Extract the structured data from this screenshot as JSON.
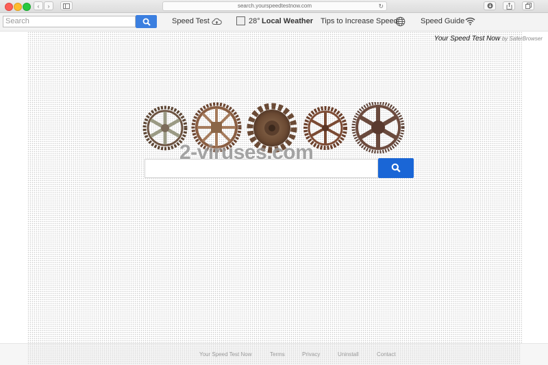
{
  "browser": {
    "url": "search.yourspeedtestnow.com"
  },
  "toolbar": {
    "search_placeholder": "Search",
    "speed_test_label": "Speed Test",
    "weather_temp": "28°",
    "weather_label": "Local Weather",
    "tips_label": "Tips to Increase Speed",
    "speed_guide_label": "Speed Guide"
  },
  "brand": {
    "name": "Your Speed Test Now",
    "by": "by SaferBrowser"
  },
  "watermark": "2-viruses.com",
  "footer": {
    "links": [
      "Your Speed Test Now",
      "Terms",
      "Privacy",
      "Uninstall",
      "Contact"
    ]
  },
  "colors": {
    "search_button": "#1a66d6",
    "toolbar_search_button": "#3b7fe0"
  }
}
